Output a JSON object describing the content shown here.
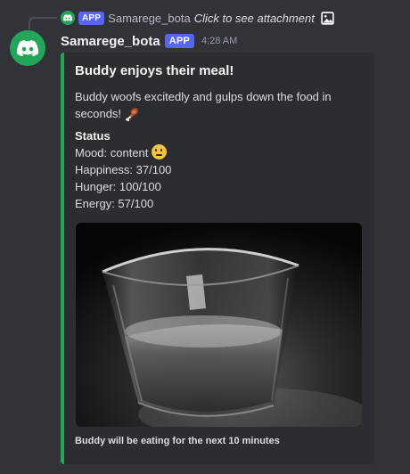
{
  "reply": {
    "tag": "APP",
    "author": "Samarege_bota",
    "text": "Click to see attachment"
  },
  "message": {
    "author": "Samarege_bota",
    "tag": "APP",
    "time": "4:28 AM"
  },
  "embed": {
    "accent_color": "#23a55a",
    "title": "Buddy enjoys their meal!",
    "description": "Buddy woofs excitedly and gulps down the food in seconds!",
    "field_name": "Status",
    "status": {
      "mood": "Mood: content",
      "happiness": "Happiness: 37/100",
      "hunger": "Hunger: 100/100",
      "energy": "Energy: 57/100"
    },
    "footer": "Buddy will be eating for the next 10 minutes"
  },
  "icons": {
    "reply_attachment": "image-icon",
    "avatar": "discord-logo-icon",
    "mood": "neutral-face-emoji",
    "description": "meat-on-bone-emoji"
  }
}
